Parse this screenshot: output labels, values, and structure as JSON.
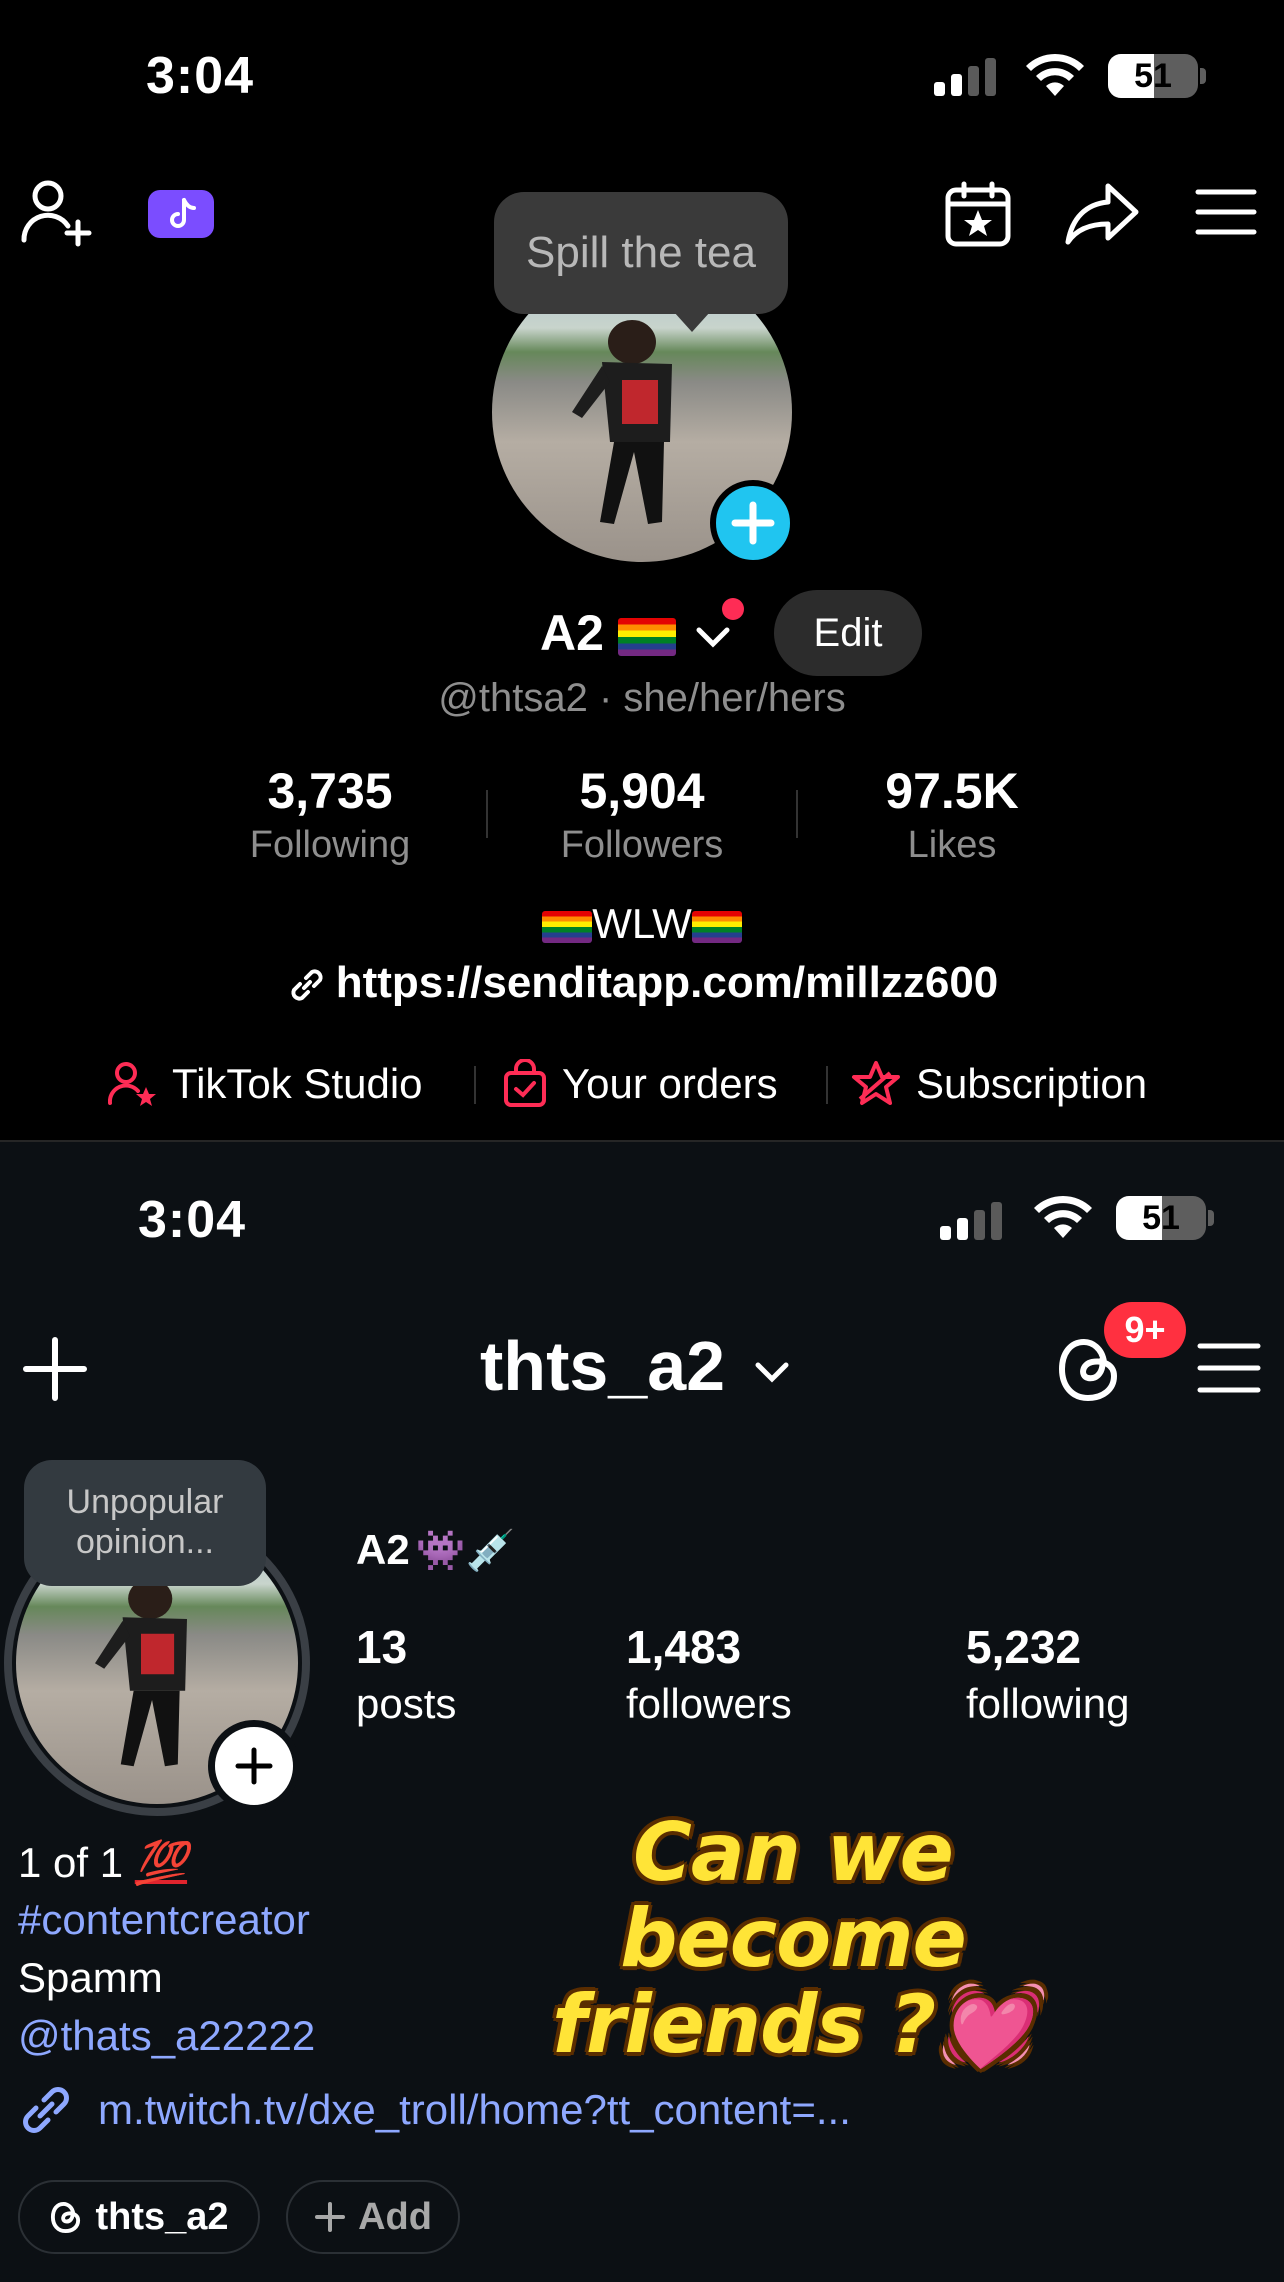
{
  "tiktok": {
    "status": {
      "time": "3:04",
      "battery": "51"
    },
    "tooltip": "Spill the tea",
    "name": "A2",
    "edit_label": "Edit",
    "handle_line": "@thtsa2 · she/her/hers",
    "stats": [
      {
        "value": "3,735",
        "label": "Following"
      },
      {
        "value": "5,904",
        "label": "Followers"
      },
      {
        "value": "97.5K",
        "label": "Likes"
      }
    ],
    "bio_text": "WLW",
    "link": "https://senditapp.com/millzz600",
    "tools": [
      {
        "label": "TikTok Studio",
        "icon": "person-star-icon"
      },
      {
        "label": "Your orders",
        "icon": "shopping-bag-icon"
      },
      {
        "label": "Subscription",
        "icon": "star-ribbon-icon"
      }
    ],
    "accent_color": "#fe2c55",
    "plus_color": "#20c5f0"
  },
  "instagram": {
    "status": {
      "time": "3:04",
      "battery": "51"
    },
    "username": "thts_a2",
    "notification_count": "9+",
    "tooltip": "Unpopular opinion...",
    "name": "A2",
    "name_emojis": "👾💉",
    "stats": [
      {
        "value": "13",
        "label": "posts"
      },
      {
        "value": "1,483",
        "label": "followers"
      },
      {
        "value": "5,232",
        "label": "following"
      }
    ],
    "bio": {
      "line1": "1 of 1",
      "line1_emoji": "💯",
      "hashtag": "#contentcreator",
      "line3": "Spamm",
      "mention": "@thats_a22222",
      "link": "m.twitch.tv/dxe_troll/home?tt_content=..."
    },
    "overlay_text_line1": "Can we become",
    "overlay_text_line2": "friends ?💓",
    "threads_pill": "thts_a2",
    "add_pill": "Add",
    "link_color": "#8ea8ff"
  }
}
